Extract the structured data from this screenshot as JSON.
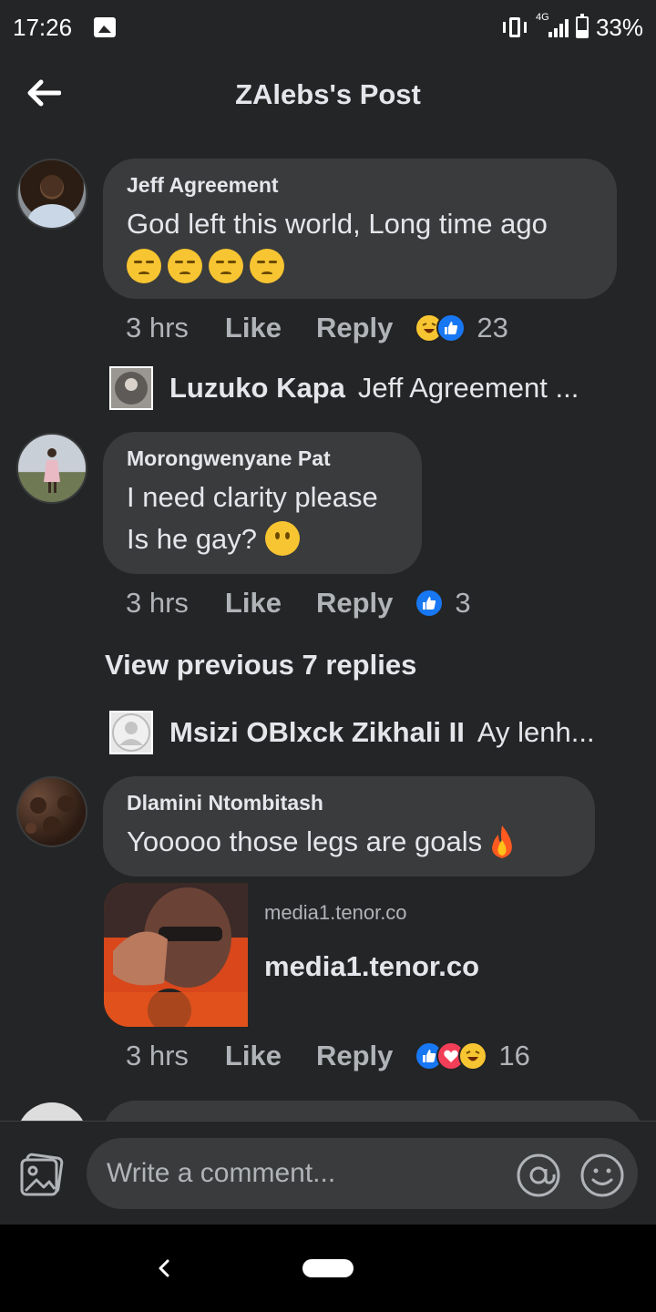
{
  "status": {
    "time": "17:26",
    "network": "4G",
    "battery": "33%",
    "battery_level": 0.33
  },
  "header": {
    "title": "ZAlebs's Post"
  },
  "comments": [
    {
      "name": "Jeff Agreement",
      "text": "God left this  world, Long time ago",
      "time": "3 hrs",
      "like": "Like",
      "reply": "Reply",
      "reaction_count": "23"
    },
    {
      "name": "Morongwenyane Pat",
      "text": "I need clarity please\nIs he gay?",
      "time": "3 hrs",
      "like": "Like",
      "reply": "Reply",
      "reaction_count": "3"
    },
    {
      "name": "Dlamini Ntombitash",
      "text": "Yooooo those legs are goals",
      "time": "3 hrs",
      "like": "Like",
      "reply": "Reply",
      "reaction_count": "16"
    }
  ],
  "replies": [
    {
      "name": "Luzuko Kapa",
      "snippet": "Jeff Agreement ..."
    },
    {
      "name": "Msizi OBlxck Zikhali II",
      "snippet": "Ay lenh..."
    }
  ],
  "view_previous": "View previous 7 replies",
  "link_card": {
    "domain": "media1.tenor.co",
    "title": "media1.tenor.co"
  },
  "composer": {
    "placeholder": "Write a comment..."
  },
  "colors": {
    "background": "#242526",
    "bubble": "#3a3b3c",
    "like_blue": "#1877f2",
    "love_red": "#f33e58",
    "haha_yellow": "#f7c531"
  },
  "icons": [
    "back-arrow-icon",
    "gallery-icon",
    "vibrate-icon",
    "signal-icon",
    "battery-icon",
    "sad-emoji-icon",
    "neutral-emoji-icon",
    "fire-emoji-icon",
    "like-reaction-icon",
    "love-reaction-icon",
    "haha-reaction-icon",
    "photo-icon",
    "at-icon",
    "smiley-icon",
    "nav-back-icon",
    "home-pill-icon"
  ]
}
